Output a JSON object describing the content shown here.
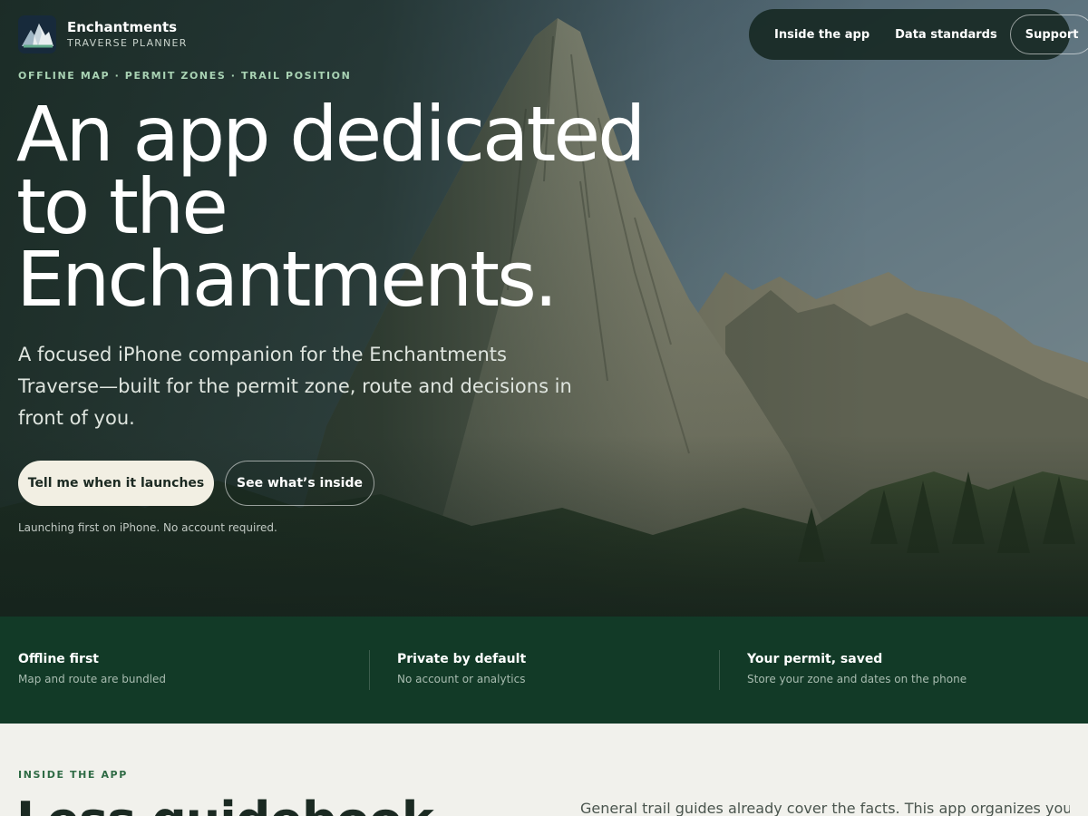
{
  "brand": {
    "name": "Enchantments",
    "subtitle": "TRAVERSE PLANNER",
    "logo_icon": "mountain-icon"
  },
  "nav": {
    "links": [
      "Inside the app",
      "Data standards"
    ],
    "support_label": "Support"
  },
  "hero": {
    "kicker": "OFFLINE MAP · PERMIT ZONES · TRAIL POSITION",
    "headline_lines": [
      "An app dedicated",
      "to the",
      "Enchantments."
    ],
    "lede": "A focused iPhone companion for the Enchantments Traverse—built for the permit zone, route and decisions in front of you.",
    "primary_button": "Tell me when it launches",
    "secondary_button": "See what’s inside",
    "note": "Launching first on iPhone. No account required."
  },
  "features": [
    {
      "title": "Offline first",
      "desc": "Map and route are bundled"
    },
    {
      "title": "Private by default",
      "desc": "No account or analytics"
    },
    {
      "title": "Your permit, saved",
      "desc": "Store your zone and dates on the phone"
    }
  ],
  "inside": {
    "kicker": "INSIDE THE APP",
    "title": "Less guidebook",
    "body": "General trail guides already cover the facts. This app organizes your"
  },
  "colors": {
    "band": "#123a27",
    "page_bg": "#f1f1ec",
    "kicker_accent": "#a9d3b4",
    "button_primary_bg": "#f2efe3"
  }
}
